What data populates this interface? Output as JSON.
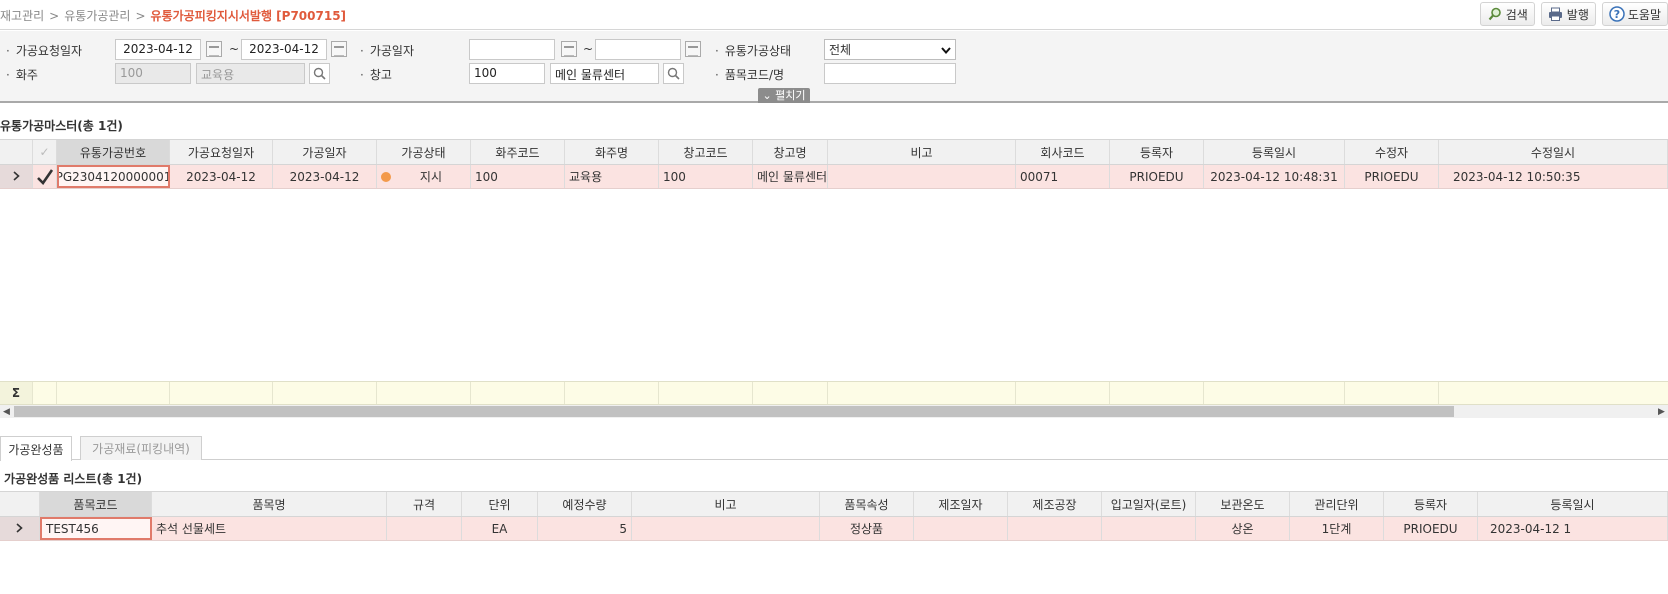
{
  "breadcrumb": {
    "items": [
      "재고관리",
      "유통가공관리"
    ],
    "current": "유통가공피킹지시서발행 [P700715]"
  },
  "toolbar": {
    "search_label": "검색",
    "print_label": "발행",
    "help_label": "도움말"
  },
  "search": {
    "req_date_label": "가공요청일자",
    "req_date_from": "2023-04-12",
    "req_date_to": "2023-04-12",
    "proc_date_label": "가공일자",
    "proc_date_from": "",
    "proc_date_to": "",
    "status_label": "유통가공상태",
    "status_value": "전체",
    "owner_label": "화주",
    "owner_code": "100",
    "owner_name": "교육용",
    "warehouse_label": "창고",
    "warehouse_code": "100",
    "warehouse_name": "메인 물류센터",
    "item_label": "품목코드/명",
    "item_value": "",
    "tilde": "~",
    "fold_label": "펼치기"
  },
  "master": {
    "title": "유통가공마스터(총 1건)",
    "columns": [
      "유통가공번호",
      "가공요청일자",
      "가공일자",
      "가공상태",
      "화주코드",
      "화주명",
      "창고코드",
      "창고명",
      "비고",
      "회사코드",
      "등록자",
      "등록일시",
      "수정자",
      "수정일시"
    ],
    "row": {
      "no": "PG2304120000001",
      "req_date": "2023-04-12",
      "proc_date": "2023-04-12",
      "status": "지시",
      "owner_code": "100",
      "owner_name": "교육용",
      "wh_code": "100",
      "wh_name": "메인 물류센터",
      "note": "",
      "company": "00071",
      "reg_user": "PRIOEDU",
      "reg_time": "2023-04-12 10:48:31",
      "mod_user": "PRIOEDU",
      "mod_time": "2023-04-12 10:50:35"
    },
    "sum_symbol": "Σ"
  },
  "tabs": [
    "가공완성품",
    "가공재료(피킹내역)"
  ],
  "detail": {
    "title": "가공완성품 리스트(총 1건)",
    "columns": [
      "품목코드",
      "품목명",
      "규격",
      "단위",
      "예정수량",
      "비고",
      "품목속성",
      "제조일자",
      "제조공장",
      "입고일자(로트)",
      "보관온도",
      "관리단위",
      "등록자",
      "등록일시"
    ],
    "row": {
      "item_code": "TEST456",
      "item_name": "추석 선물세트",
      "spec": "",
      "unit": "EA",
      "qty": "5",
      "note": "",
      "attr": "정상품",
      "mfg_date": "",
      "factory": "",
      "lot": "",
      "temp": "상온",
      "mgmt_unit": "1단계",
      "reg_user": "PRIOEDU",
      "reg_time": "2023-04-12 1"
    }
  },
  "colors": {
    "accent": "#e05a3c",
    "row_highlight": "#fbe3e1",
    "sum_row": "#fdfce6",
    "status_dot": "#f39a4b"
  }
}
